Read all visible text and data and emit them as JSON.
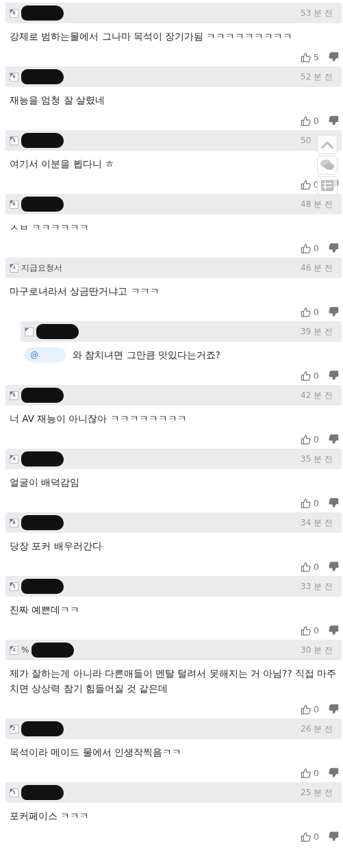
{
  "comments": [
    {
      "level": "6",
      "redacted": true,
      "time": "53 분 전",
      "text": "강제로 범하는물에서 그나마 목석이 장기가됨 ㅋㅋㅋㅋㅋㅋㅋㅋㅋ",
      "likes": "5"
    },
    {
      "level": "6",
      "redacted": true,
      "time": "52 분 전",
      "text": "재능을 엄청 잘 살렸네",
      "likes": "0"
    },
    {
      "level": "5",
      "redacted": true,
      "time": "50",
      "text": "여기서 이분을 뵙다니 ㅎ",
      "likes": "0"
    },
    {
      "level": "6",
      "redacted": true,
      "time": "48 분 전",
      "text": "ㅅㅂ ㅋㅋㅋㅋㅋㅋ",
      "likes": "0"
    },
    {
      "level": "4",
      "username": "지급요청서",
      "time": "46 분 전",
      "text": "마구로녀라서 상금딴거냐고 ㅋㅋㅋ",
      "likes": "0"
    },
    {
      "redacted": true,
      "time": "39 분 전",
      "mention": "@",
      "text": "와 참치녀면 그만큼 맛있다는거죠?",
      "likes": "0",
      "reply": true
    },
    {
      "level": "6",
      "redacted": true,
      "time": "42 분 전",
      "text": "너 AV 재능이 아니잖아 ㅋㅋㅋㅋㅋㅋㅋㅋ",
      "likes": "0"
    },
    {
      "level": "4",
      "redacted": true,
      "time": "35 분 전",
      "text": "얼굴이 배덕감임",
      "likes": "0"
    },
    {
      "level": "8",
      "redacted": true,
      "time": "34 분 전",
      "text": "당장 포커 배우러간다",
      "likes": "0"
    },
    {
      "level": "5",
      "redacted": true,
      "time": "33 분 전",
      "text": "진짜 예쁜데ㅋㅋ",
      "likes": "0"
    },
    {
      "level": "4",
      "redacted": true,
      "username": "%",
      "time": "30 분 전",
      "text": "제가 잘하는게 아니라 다른애들이 멘탈 털려서 못해지는 거 아님?? 직접 마주치면 상상력 참기 힘들어질 것 같은데",
      "likes": "0"
    },
    {
      "level": "2",
      "redacted": true,
      "time": "26 분 전",
      "text": "목석이라 메이드 물에서 인생작찍음ㅋㅋ",
      "likes": "0"
    },
    {
      "level": "5",
      "redacted": true,
      "time": "25 분 전",
      "text": "포커페이스 ㅋㅋㅋ",
      "likes": "0"
    }
  ]
}
